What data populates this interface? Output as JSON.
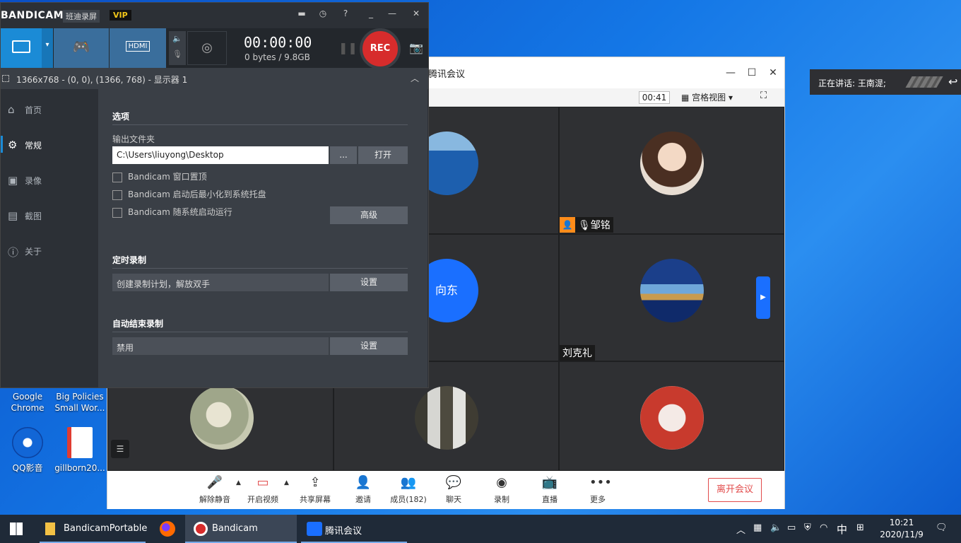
{
  "desktop": {
    "icons": [
      {
        "label": "Google Chrome"
      },
      {
        "label": "Big Policies Small Wor..."
      },
      {
        "label": "QQ影音"
      },
      {
        "label": "gillborn20..."
      }
    ]
  },
  "meeting": {
    "title": "腾讯会议",
    "timer": "00:41",
    "view_label": "宫格视图",
    "participants": [
      {
        "name": "邹铭"
      },
      {
        "name": "向东"
      },
      {
        "name": "刘克礼"
      }
    ],
    "toolbar": {
      "unmute": "解除静音",
      "video": "开启视频",
      "share": "共享屏幕",
      "invite": "邀请",
      "members": "成员(182)",
      "chat": "聊天",
      "record": "录制",
      "live": "直播",
      "more": "更多",
      "leave": "离开会议"
    },
    "speaking": "正在讲话: 王南湜;"
  },
  "bandicam": {
    "logo": "BANDICAM",
    "subtitle": "班迪录屏",
    "vip": "VIP",
    "mode_hdmi": "HDMI",
    "time": "00:00:00",
    "size": "0 bytes / 9.8GB",
    "rec": "REC",
    "area": "1366x768 - (0, 0), (1366, 768) - 显示器 1",
    "nav": [
      {
        "label": "首页",
        "icon": "home-icon"
      },
      {
        "label": "常规",
        "icon": "gear-icon"
      },
      {
        "label": "录像",
        "icon": "video-icon"
      },
      {
        "label": "截图",
        "icon": "image-icon"
      },
      {
        "label": "关于",
        "icon": "info-icon"
      }
    ],
    "options": {
      "title": "选项",
      "output_label": "输出文件夹",
      "output_path": "C:\\Users\\liuyong\\Desktop",
      "browse": "...",
      "open": "打开",
      "checkbox_topmost": "Bandicam 窗口置顶",
      "checkbox_tray": "Bandicam 启动后最小化到系统托盘",
      "checkbox_startup": "Bandicam 随系统启动运行",
      "advanced": "高级"
    },
    "schedule": {
      "title": "定时录制",
      "value": "创建录制计划，解放双手",
      "button": "设置"
    },
    "autostop": {
      "title": "自动结束录制",
      "value": "禁用",
      "button": "设置"
    }
  },
  "taskbar": {
    "items": [
      {
        "label": "BandicamPortable"
      },
      {
        "label": "Bandicam"
      },
      {
        "label": "腾讯会议"
      }
    ],
    "ime": "中",
    "time": "10:21",
    "date": "2020/11/9"
  },
  "colors": {
    "bandicam_bg": "#2c3036",
    "accent_blue": "#1b8bd6",
    "rec_red": "#d72c2c",
    "meeting_blue": "#1a6fff",
    "leave_red": "#e24b4b"
  }
}
